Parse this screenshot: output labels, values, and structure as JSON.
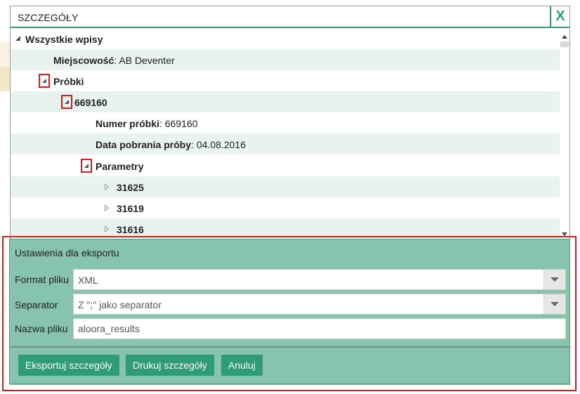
{
  "dialog": {
    "title": "SZCZEGÓŁY",
    "close_label": "X"
  },
  "tree": {
    "root_label": "Wszystkie wpisy",
    "rows": [
      {
        "key": "Miejscowość",
        "sep": ": ",
        "value": "AB Deventer"
      },
      {
        "key": "Próbki",
        "sep": "",
        "value": ""
      },
      {
        "key": "669160",
        "sep": "",
        "value": ""
      },
      {
        "key": "Numer próbki",
        "sep": ": ",
        "value": "669160"
      },
      {
        "key": "Data pobrania próby",
        "sep": ": ",
        "value": "04.08.2016"
      },
      {
        "key": "Parametry",
        "sep": "",
        "value": ""
      },
      {
        "key": "31625",
        "sep": "",
        "value": ""
      },
      {
        "key": "31619",
        "sep": "",
        "value": ""
      },
      {
        "key": "31616",
        "sep": "",
        "value": ""
      }
    ]
  },
  "export": {
    "heading": "Ustawienia dla eksportu",
    "format_label": "Format pliku",
    "format_value": "XML",
    "separator_label": "Separator",
    "separator_value": "Z \";\" jako separator",
    "filename_label": "Nazwa pliku",
    "filename_value": "aloora_results",
    "buttons": {
      "export": "Eksportuj szczegóły",
      "print": "Drukuj szczegóły",
      "cancel": "Anuluj"
    }
  },
  "colors": {
    "accent": "#2e9c74",
    "panel": "#86c4ad",
    "highlight": "#d62020"
  }
}
